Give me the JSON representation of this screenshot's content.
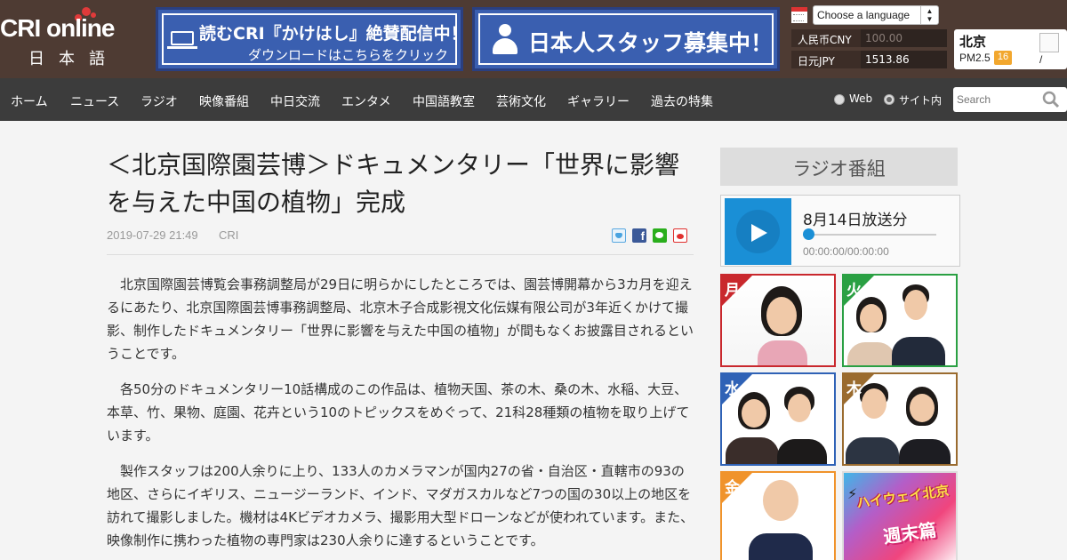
{
  "header": {
    "logo_text": "CRI online",
    "logo_sub": "日本語",
    "banner1": {
      "title": "読むCRI『かけはし』絶賛配信中！",
      "subtitle": "ダウンロードはこちらをクリック",
      "icon": "laptop-icon"
    },
    "banner2": {
      "title": "日本人スタッフ募集中！",
      "icon": "person-icon"
    },
    "language_select": {
      "value": "Choose a language"
    },
    "rates": [
      {
        "currency": "人民币CNY",
        "value": "100.00"
      },
      {
        "currency": "日元JPY",
        "value": "1513.86"
      }
    ],
    "weather": {
      "city": "北京",
      "pm_label": "PM2.5",
      "pm_value": "16",
      "temp": "/"
    }
  },
  "nav": {
    "items": [
      "ホーム",
      "ニュース",
      "ラジオ",
      "映像番組",
      "中日交流",
      "エンタメ",
      "中国語教室",
      "芸術文化",
      "ギャラリー",
      "過去の特集"
    ],
    "radio_web": "Web",
    "radio_site": "サイト内",
    "search_placeholder": "Search"
  },
  "article": {
    "title": "＜北京国際園芸博＞ドキュメンタリー「世界に影響を与えた中国の植物」完成",
    "date": "2019-07-29 21:49",
    "source": "CRI",
    "paragraphs": [
      "北京国際園芸博覧会事務調整局が29日に明らかにしたところでは、園芸博開幕から3カ月を迎えるにあたり、北京国際園芸博事務調整局、北京木子合成影視文化伝媒有限公司が3年近くかけて撮影、制作したドキュメンタリー「世界に影響を与えた中国の植物」が間もなくお披露目されるということです。",
      "各50分のドキュメンタリー10話構成のこの作品は、植物天国、茶の木、桑の木、水稲、大豆、本草、竹、果物、庭園、花卉という10のトピックスをめぐって、21科28種類の植物を取り上げています。",
      "製作スタッフは200人余りに上り、133人のカメラマンが国内27の省・自治区・直轄市の93の地区、さらにイギリス、ニュージーランド、インド、マダガスカルなど7つの国の30以上の地区を訪れて撮影しました。機材は4Kビデオカメラ、撮影用大型ドローンなどが使われています。また、映像制作に携わった植物の専門家は230人余りに達するということです。"
    ]
  },
  "sidebar": {
    "heading": "ラジオ番組",
    "player": {
      "episode": "8月14日放送分",
      "time": "00:00:00/00:00:00",
      "progress": 0
    },
    "days": [
      "月",
      "火",
      "水",
      "木",
      "金"
    ],
    "weekend": {
      "title": "ハイウェイ北京",
      "subtitle": "週末篇"
    }
  }
}
